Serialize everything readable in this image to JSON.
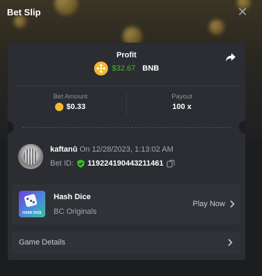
{
  "header": {
    "title": "Bet Slip"
  },
  "profit": {
    "label": "Profit",
    "value": "$32.67",
    "currency": "BNB"
  },
  "stats": {
    "bet_amount_label": "Bet Amount",
    "bet_amount_value": "$0.33",
    "payout_label": "Payout",
    "payout_value": "100 x"
  },
  "bet": {
    "username": "kaftanû",
    "date_text": "On 12/28/2023, 1:13:02 AM",
    "bet_id_label": "Bet ID:",
    "bet_id": "119224190443211461"
  },
  "game": {
    "name": "Hash Dice",
    "provider": "BC Originals",
    "play_label": "Play Now"
  },
  "details": {
    "label": "Game Details"
  },
  "colors": {
    "profit_green": "#3bc117",
    "coin_gold": "#f3ba2f",
    "card_bg": "#2b2d32",
    "panel_bg": "#1c1d21"
  },
  "icons": [
    "close-icon",
    "share-icon",
    "bnb-coin-icon",
    "shield-icon",
    "copy-icon",
    "chevron-right-icon"
  ]
}
